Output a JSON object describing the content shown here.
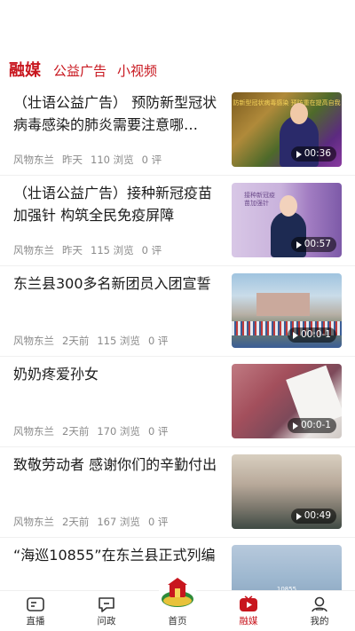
{
  "top_tabs": [
    {
      "label": "融媒",
      "active": true
    },
    {
      "label": "公益广告",
      "active": false
    },
    {
      "label": "小视频",
      "active": false
    }
  ],
  "thumb_texts": {
    "t1": "防新型冠状病毒感染 预防重在提高自我",
    "t2": "接种新冠疫苗加强针",
    "t6": "10855"
  },
  "feed": [
    {
      "title": "（壮语公益广告） 预防新型冠状病毒感染的肺炎需要注意哪…",
      "source": "风物东兰",
      "time": "昨天",
      "views": "110 浏览",
      "comments": "0 评",
      "duration": "00:36"
    },
    {
      "title": "（壮语公益广告）接种新冠疫苗加强针 构筑全民免疫屏障",
      "source": "风物东兰",
      "time": "昨天",
      "views": "115 浏览",
      "comments": "0 评",
      "duration": "00:57"
    },
    {
      "title": "东兰县300多名新团员入团宣誓",
      "source": "风物东兰",
      "time": "2天前",
      "views": "115 浏览",
      "comments": "0 评",
      "duration": "00:0-1"
    },
    {
      "title": "奶奶疼爱孙女",
      "source": "风物东兰",
      "time": "2天前",
      "views": "170 浏览",
      "comments": "0 评",
      "duration": "00:0-1"
    },
    {
      "title": "致敬劳动者 感谢你们的辛勤付出",
      "source": "风物东兰",
      "time": "2天前",
      "views": "167 浏览",
      "comments": "0 评",
      "duration": "00:49"
    },
    {
      "title": "“海巡10855”在东兰县正式列编",
      "source": "",
      "time": "",
      "views": "",
      "comments": "",
      "duration": ""
    }
  ],
  "tabbar": [
    {
      "label": "直播",
      "icon": "live-tv-icon",
      "active": false
    },
    {
      "label": "问政",
      "icon": "chat-bubble-icon",
      "active": false
    },
    {
      "label": "首页",
      "icon": "home-emblem-icon",
      "active": false
    },
    {
      "label": "融媒",
      "icon": "video-play-icon",
      "active": true
    },
    {
      "label": "我的",
      "icon": "user-icon",
      "active": false
    }
  ],
  "colors": {
    "accent": "#c8161e",
    "text": "#1a1a1a",
    "meta": "#8a8a8a"
  }
}
